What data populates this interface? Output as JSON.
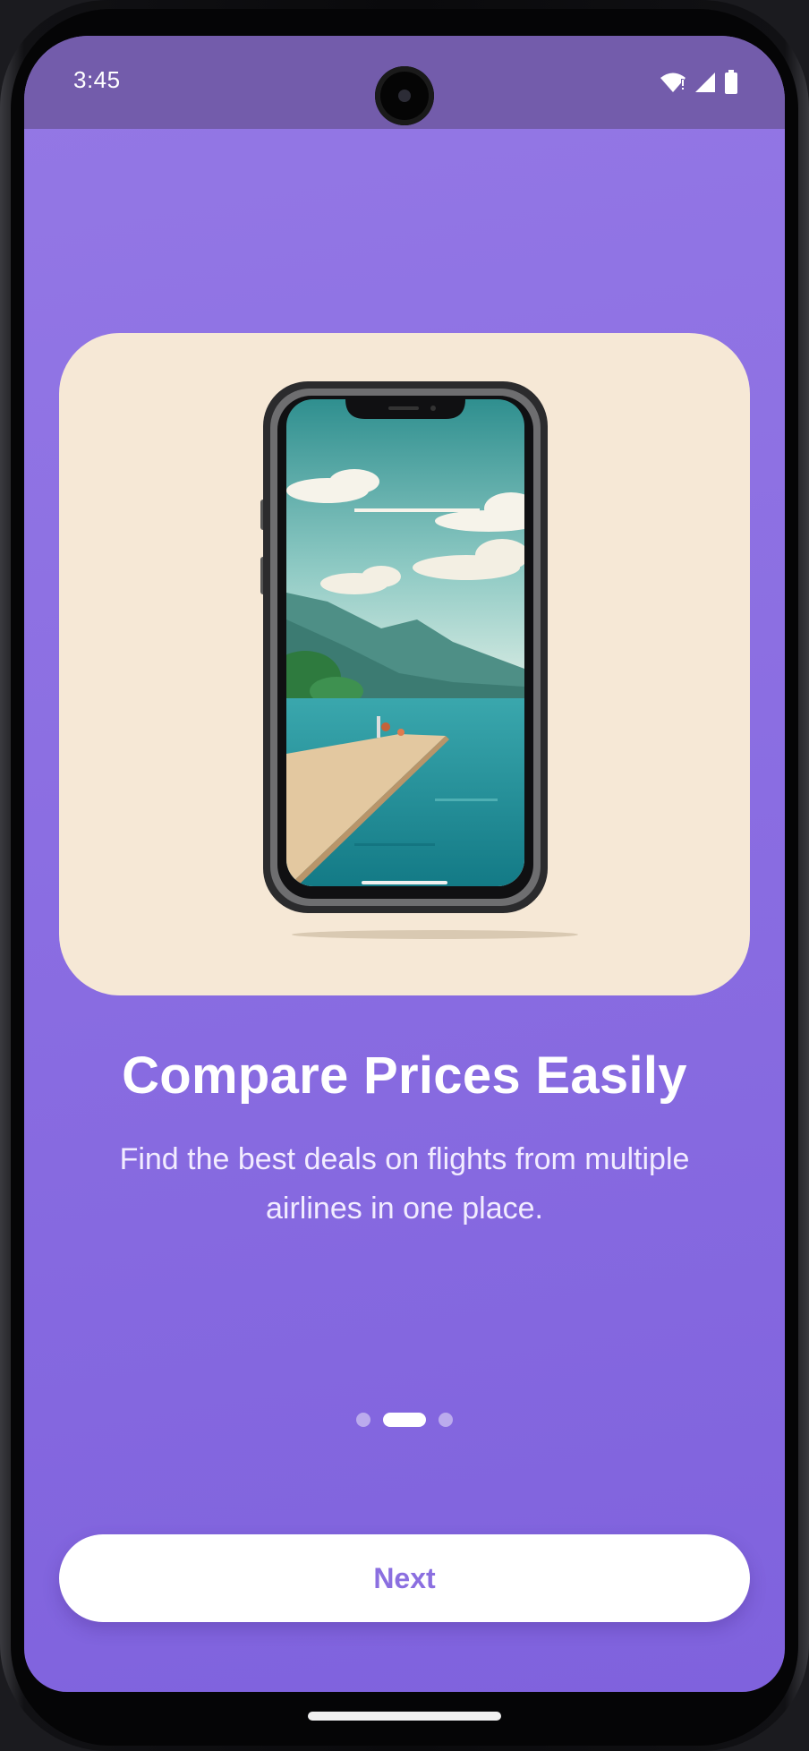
{
  "status_bar": {
    "time": "3:45",
    "icons": [
      "wifi-icon",
      "cellular-signal-icon",
      "battery-icon"
    ]
  },
  "onboarding": {
    "illustration": "phone-with-lake-landscape",
    "title": "Compare Prices Easily",
    "description": "Find the best deals on flights from multiple airlines in one place.",
    "page_indicator": {
      "total": 3,
      "current": 2
    },
    "next_label": "Next"
  },
  "colors": {
    "background_top": "#9478e5",
    "background_bottom": "#7f62dd",
    "status_bar": "#735cab",
    "card": "#f6e8d6",
    "accent_text": "#8b6fe0"
  }
}
